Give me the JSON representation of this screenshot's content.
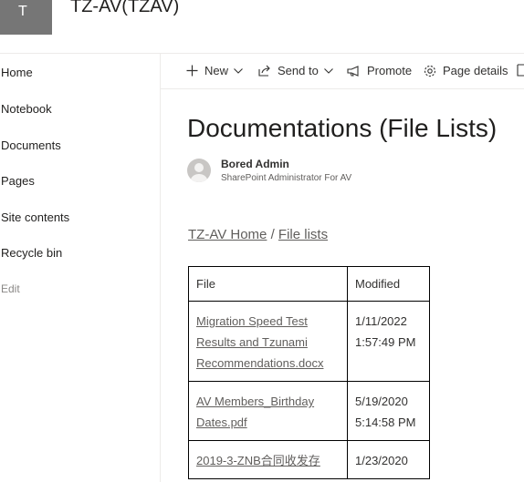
{
  "site": {
    "logo_letter": "T",
    "title": "TZ-AV(TZAV)"
  },
  "leftnav": {
    "items": [
      {
        "label": "Home"
      },
      {
        "label": "Notebook"
      },
      {
        "label": "Documents"
      },
      {
        "label": "Pages"
      },
      {
        "label": "Site contents"
      },
      {
        "label": "Recycle bin"
      }
    ],
    "edit_label": "Edit"
  },
  "commandbar": {
    "new_label": "New",
    "sendto_label": "Send to",
    "promote_label": "Promote",
    "pagedetails_label": "Page details"
  },
  "page": {
    "title": "Documentations (File Lists)",
    "author": {
      "name": "Bored Admin",
      "role": "SharePoint Administrator For AV"
    },
    "breadcrumb": {
      "home": "TZ-AV Home",
      "separator": " / ",
      "current": "File lists"
    }
  },
  "table": {
    "headers": {
      "file": "File",
      "modified": "Modified"
    },
    "rows": [
      {
        "file": "Migration Speed Test Results and Tzunami Recommendations.docx",
        "modified": "1/11/2022 1:57:49 PM"
      },
      {
        "file": "AV Members_Birthday Dates.pdf",
        "modified": "5/19/2020 5:14:58 PM"
      },
      {
        "file": "2019-3-ZNB合同收发存",
        "modified": "1/23/2020"
      }
    ]
  },
  "colors": {
    "accent": "#767676",
    "link": "#605e5c",
    "border": "#edebe9"
  }
}
